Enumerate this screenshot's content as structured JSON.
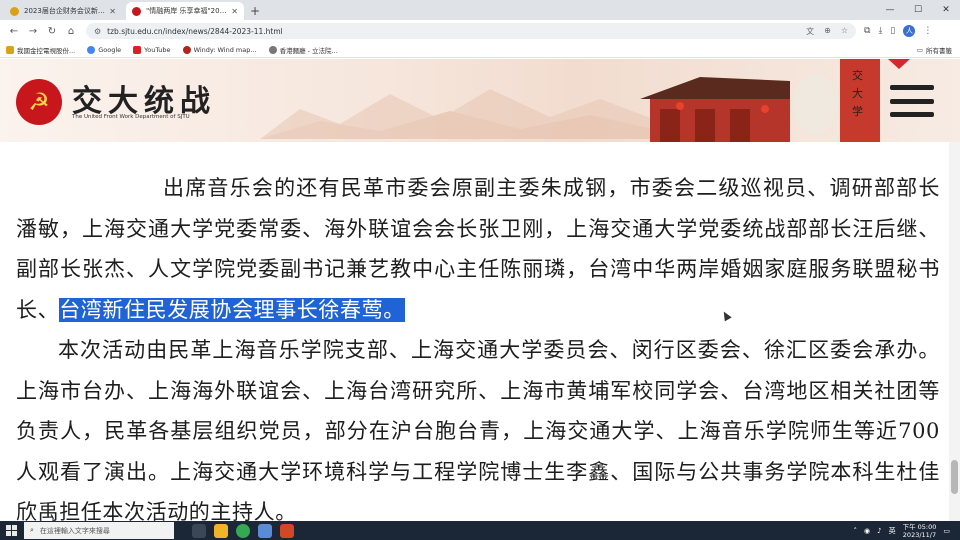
{
  "browser": {
    "tabs": [
      {
        "title": "2023届台企财务会议新闻报道...",
        "active": false
      },
      {
        "title": "\"情融两岸 乐享幸福\"2023沪台...",
        "active": true
      }
    ],
    "window_controls": {
      "minimize": "—",
      "maximize": "☐",
      "close": "✕"
    },
    "url": "tzb.sjtu.edu.cn/index/news/2844-2023-11.html",
    "bookmarks": [
      {
        "label": "我國金控電視股份...",
        "color": "#d9a21b"
      },
      {
        "label": "Google",
        "color": "#4285f4"
      },
      {
        "label": "YouTube",
        "color": "#e02020"
      },
      {
        "label": "Windy: Wind map...",
        "color": "#b3261e"
      },
      {
        "label": "香港麵廳 - 立法院...",
        "color": "#777777"
      }
    ],
    "all_bookmarks": "所有書籤",
    "profile_initial": "人"
  },
  "site": {
    "logo_cn": "交大统战",
    "logo_en": "The United Front Work Department of SJTU",
    "colors": {
      "brand_red": "#c8161d",
      "highlight": "#1f63d6"
    }
  },
  "article": {
    "p1_before": "出席音乐会的还有民革市委会原副主委朱成钢，市委会二级巡视员、调研部部长潘敏，上海交通大学党委常委、海外联谊会会长张卫刚，上海交通大学党委统战部部长汪后继、副部长张杰、人文学院党委副书记兼艺教中心主任陈丽璘，台湾中华两岸婚姻家庭服务联盟秘书长、",
    "p1_highlight": "台湾新住民发展协会理事长徐春莺。",
    "p2": "本次活动由民革上海音乐学院支部、上海交通大学委员会、闵行区委会、徐汇区委会承办。上海市台办、上海海外联谊会、上海台湾研究所、上海市黄埔军校同学会、台湾地区相关社团等负责人，民革各基层组织党员，部分在沪台胞台青，上海交通大学、上海音乐学院师生等近700人观看了演出。上海交通大学环境科学与工程学院博士生李鑫、国际与公共事务学院本科生杜佳欣禹担任本次活动的主持人。"
  },
  "taskbar": {
    "search_placeholder": "在這裡輸入文字來搜尋",
    "ime": "英",
    "time": "下午 05:00",
    "date": "2023/11/7"
  }
}
